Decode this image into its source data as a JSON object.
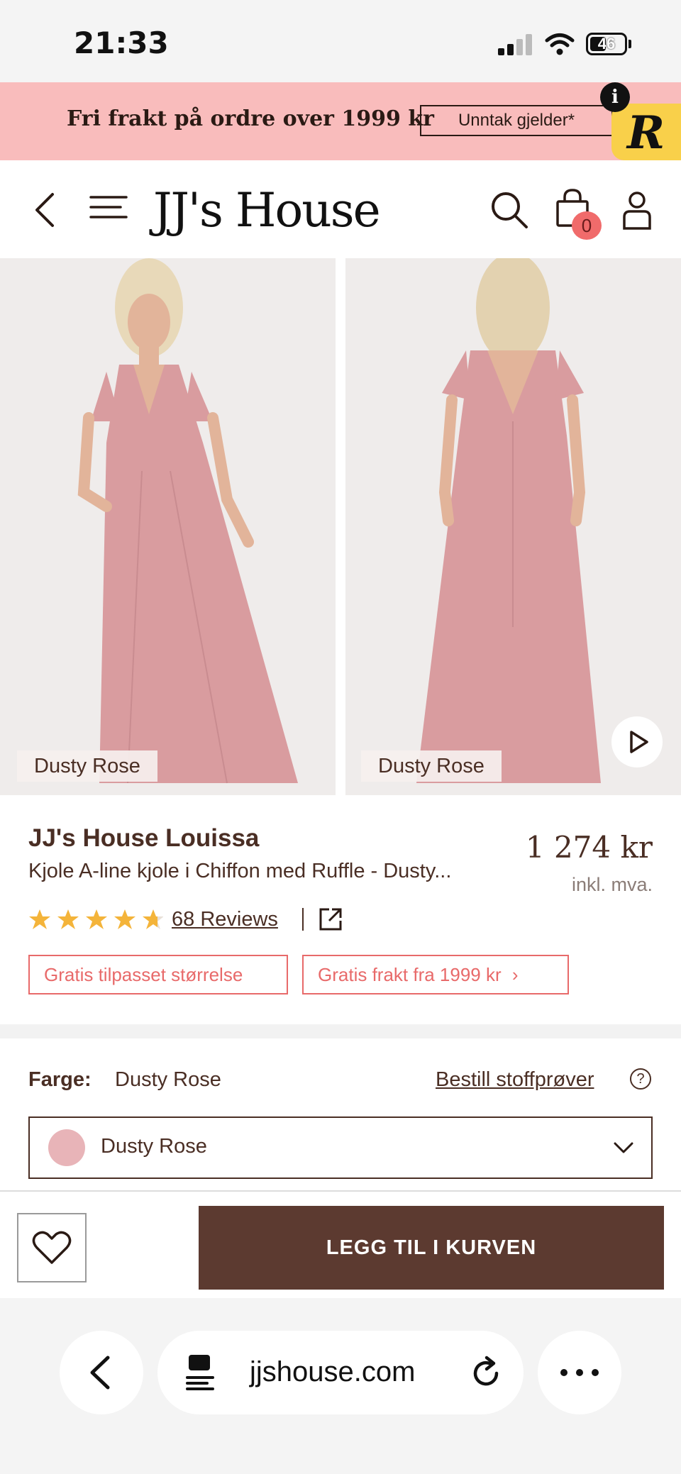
{
  "status_bar": {
    "time": "21:33",
    "battery": "46"
  },
  "promo": {
    "text": "Fri frakt på ordre over 1999 kr",
    "button_label": "Unntak gjelder*",
    "badge_letter": "R",
    "info_label": "i"
  },
  "header": {
    "logo": "JJ's House",
    "cart_count": "0"
  },
  "gallery": {
    "images": [
      {
        "alt": "Dusty Rose dress front view",
        "tag": "Dusty Rose"
      },
      {
        "alt": "Dusty Rose dress back view",
        "tag": "Dusty Rose"
      }
    ]
  },
  "product": {
    "brand": "JJ's House Louissa",
    "subtitle": "Kjole A-line kjole i Chiffon med Ruffle - Dusty...",
    "price": "1 274 kr",
    "vat_note": "inkl. mva.",
    "rating": 4.7,
    "reviews_label": "68 Reviews",
    "pills": [
      "Gratis tilpasset størrelse",
      "Gratis frakt fra 1999 kr"
    ]
  },
  "color": {
    "label": "Farge:",
    "value": "Dusty Rose",
    "swatch_link": "Bestill stoffprøver",
    "help": "?",
    "selected": "Dusty Rose",
    "swatch_color": "#e8b4b8"
  },
  "actions": {
    "add_to_cart": "LEGG TIL I KURVEN"
  },
  "browser": {
    "url": "jjshouse.com"
  },
  "colors": {
    "accent_pink": "#f9bcbc",
    "brand_brown": "#5c3a30",
    "coupon_red": "#e86a6a",
    "star_gold": "#f4b43a"
  }
}
